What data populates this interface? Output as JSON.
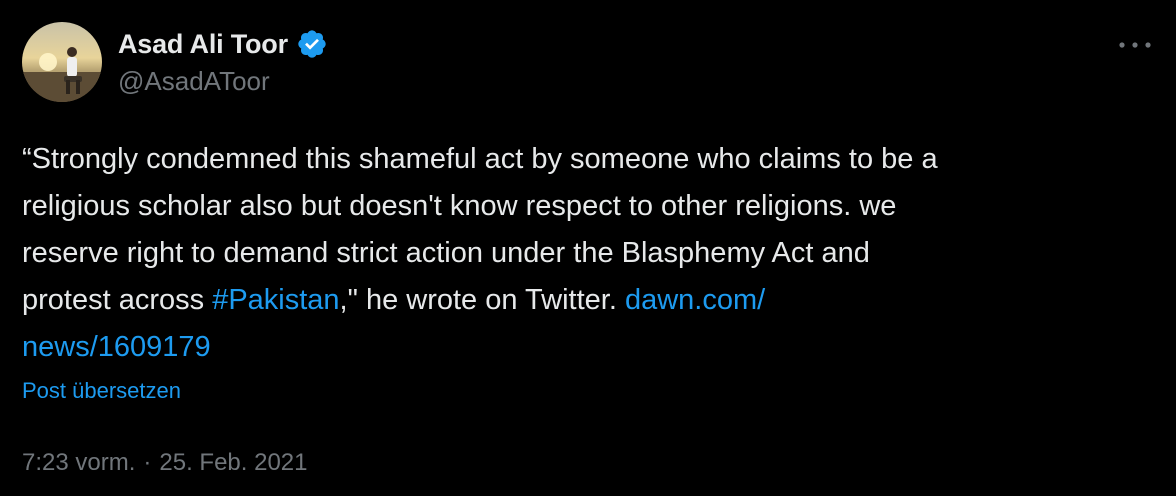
{
  "author": {
    "display_name": "Asad Ali Toor",
    "handle": "@AsadAToor",
    "verified_color": "#1d9bf0"
  },
  "post": {
    "lines": [
      "“Strongly condemned this shameful act by someone who claims to be a",
      "religious scholar also but doesn't know respect to other religions. we",
      "reserve right to demand strict action under the Blasphemy Act and"
    ],
    "line4_prefix": "protest across ",
    "hashtag": "#Pakistan",
    "line4_middle": ",\" he wrote on Twitter. ",
    "link_part1": "dawn.com/",
    "link_part2": "news/1609179",
    "translate_label": "Post übersetzen"
  },
  "meta": {
    "time": "7:23 vorm.",
    "separator": "·",
    "date": "25. Feb. 2021"
  },
  "icons": {
    "verified": "verified-badge-icon",
    "more": "more-options-icon"
  },
  "colors": {
    "background": "#000000",
    "text": "#e7e9ea",
    "secondary": "#71767b",
    "accent": "#1d9bf0"
  }
}
